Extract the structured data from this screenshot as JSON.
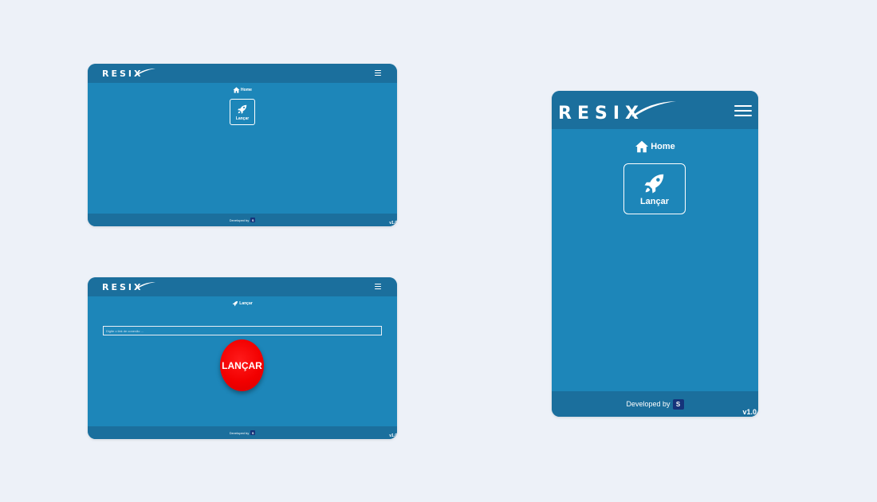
{
  "brand": "RESIX",
  "colors": {
    "background": "#edf1f8",
    "app_body": "#1d86b9",
    "app_bar": "#1b6f9d",
    "launch_button": "#f20000",
    "dev_badge": "#15337a"
  },
  "icons": {
    "menu": "hamburger-icon",
    "home": "home-icon",
    "launch": "rocket-icon",
    "developer": "s-logo-icon"
  },
  "home_desktop": {
    "breadcrumb": "Home",
    "tile_label": "Lançar",
    "footer": "Developed by",
    "dev_badge_letter": "S",
    "version": "v1.0"
  },
  "launch_desktop": {
    "breadcrumb": "Lançar",
    "input_placeholder": "Digite o link de conexão ...",
    "input_value": "",
    "launch_button": "LANÇAR",
    "footer": "Developed by",
    "dev_badge_letter": "S",
    "version": "v1.0"
  },
  "home_mobile": {
    "breadcrumb": "Home",
    "tile_label": "Lançar",
    "footer": "Developed by",
    "dev_badge_letter": "S",
    "version": "v1.0"
  }
}
